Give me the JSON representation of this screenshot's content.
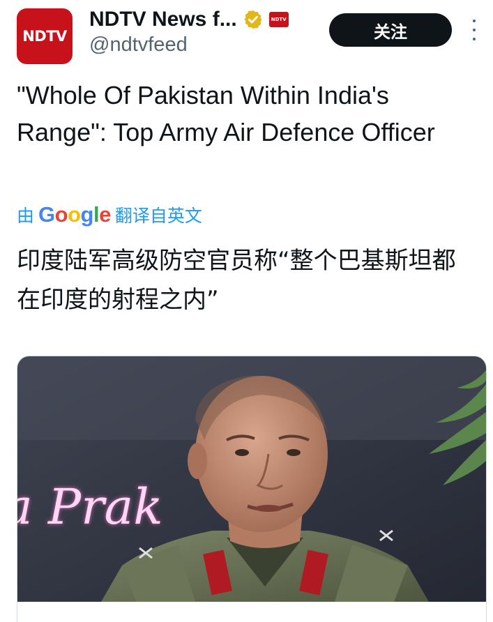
{
  "author": {
    "avatar_text": "NDTV",
    "display_name": "NDTV News f...",
    "handle": "@ndtvfeed",
    "affiliation_badge_text": "NDTV",
    "brand_color": "#c8121b",
    "verified_color": "#e2b719"
  },
  "actions": {
    "follow_label": "关注",
    "more_icon": "more-vertical-icon"
  },
  "tweet": {
    "text": "\"Whole Of Pakistan Within India's Range\": Top Army Air Defence Officer",
    "translated_by_prefix": "由",
    "translated_by_logo": "Google",
    "translated_by_suffix": "翻译自英文",
    "translation": "印度陆军高级防空官员称“整个巴基斯坦都在印度的射程之内”"
  },
  "media": {
    "neon_sign_text": "a Prak",
    "accent": "#1d9bf0"
  }
}
